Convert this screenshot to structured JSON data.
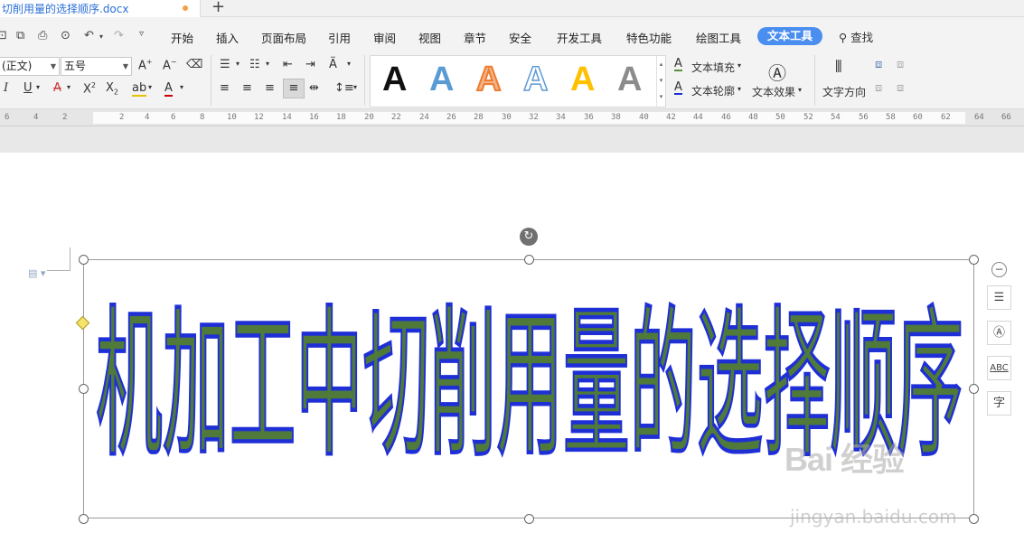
{
  "window": {
    "doc_title": "切削用量的选择顺序.docx",
    "new_tab": "+"
  },
  "menu": {
    "items": [
      "开始",
      "插入",
      "页面布局",
      "引用",
      "审阅",
      "视图",
      "章节",
      "安全",
      "开发工具",
      "特色功能",
      "绘图工具"
    ],
    "active": "文本工具",
    "search": "查找"
  },
  "font": {
    "family": "(正文)",
    "size": "五号"
  },
  "text_styles": {
    "sample_glyph": "A",
    "samples": [
      {
        "name": "black",
        "color": "#111111"
      },
      {
        "name": "blue",
        "color": "#5b9bd5"
      },
      {
        "name": "orange-outline",
        "color": "#f4b183"
      },
      {
        "name": "blue-outline",
        "color": "#ffffff"
      },
      {
        "name": "gold",
        "color": "#ffc000"
      },
      {
        "name": "gray-gradient",
        "color": "#8c8c8c"
      }
    ]
  },
  "text_tools": {
    "fill": "文本填充",
    "outline": "文本轮廓",
    "effect": "文本效果",
    "direction": "文字方向"
  },
  "ruler": {
    "ticks": [
      "6",
      "4",
      "2",
      "2",
      "4",
      "6",
      "8",
      "10",
      "12",
      "14",
      "16",
      "18",
      "20",
      "22",
      "24",
      "26",
      "28",
      "30",
      "32",
      "34",
      "36",
      "38",
      "40",
      "42",
      "44",
      "46",
      "48",
      "50",
      "52",
      "54",
      "56",
      "58",
      "60",
      "62",
      "64",
      "66"
    ]
  },
  "document": {
    "wordart_text": "机加工中切削用量的选择顺序",
    "wordart_fill": "#4f7a3a",
    "wordart_outline": "#1f2fd6"
  },
  "side_tools": [
    "layout-icon",
    "text-style-icon",
    "spell-icon",
    "char-icon"
  ],
  "watermark": {
    "main": "Bai 经验",
    "sub": "jingyan.baidu.com"
  }
}
